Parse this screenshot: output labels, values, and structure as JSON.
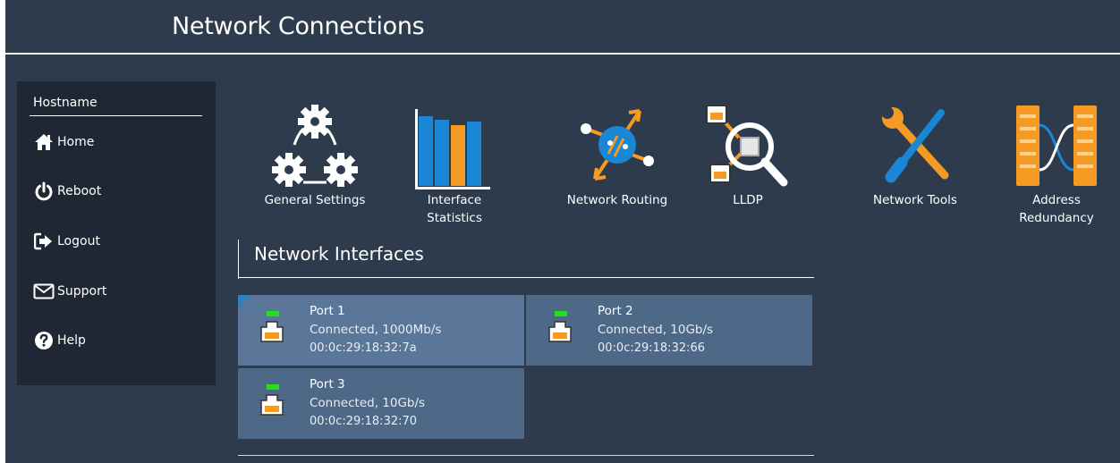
{
  "header": {
    "title": "Network Connections"
  },
  "sidebar": {
    "hostname": "Hostname",
    "items": [
      {
        "label": "Home",
        "icon": "home-icon"
      },
      {
        "label": "Reboot",
        "icon": "power-icon"
      },
      {
        "label": "Logout",
        "icon": "logout-icon"
      },
      {
        "label": "Support",
        "icon": "envelope-icon"
      },
      {
        "label": "Help",
        "icon": "question-icon"
      }
    ]
  },
  "tools": [
    {
      "label": "General Settings",
      "icon": "gears-icon"
    },
    {
      "label": "Interface Statistics",
      "icon": "bar-chart-icon"
    },
    {
      "label": "Network Routing",
      "icon": "routing-icon"
    },
    {
      "label": "LLDP",
      "icon": "lldp-icon"
    },
    {
      "label": "Network Tools",
      "icon": "wrench-screwdriver-icon"
    },
    {
      "label": "Address Redundancy",
      "icon": "redundancy-icon"
    }
  ],
  "interfaces": {
    "heading": "Network Interfaces",
    "ports": [
      {
        "name": "Port 1",
        "status": "Connected, 1000Mb/s",
        "mac": "00:0c:29:18:32:7a",
        "selected": true
      },
      {
        "name": "Port 2",
        "status": "Connected, 10Gb/s",
        "mac": "00:0c:29:18:32:66",
        "selected": false
      },
      {
        "name": "Port 3",
        "status": "Connected, 10Gb/s",
        "mac": "00:0c:29:18:32:70",
        "selected": false
      }
    ]
  },
  "colors": {
    "background": "#2e3b4c",
    "sidebar": "#1e2733",
    "port_tile": "#4e6888",
    "port_selected": "#5a7699",
    "led": "#22e01a",
    "accent_blue": "#1a86d6",
    "accent_orange": "#f59a23"
  }
}
